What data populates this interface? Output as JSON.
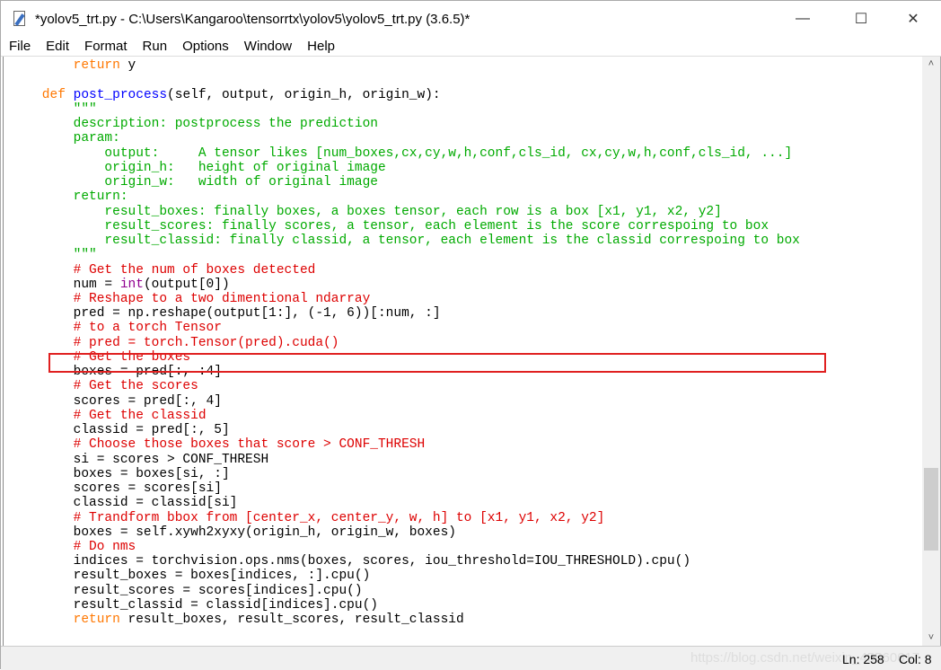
{
  "window": {
    "title": "*yolov5_trt.py - C:\\Users\\Kangaroo\\tensorrtx\\yolov5\\yolov5_trt.py (3.6.5)*",
    "minimize": "—",
    "maximize": "☐",
    "close": "✕"
  },
  "menu": [
    "File",
    "Edit",
    "Format",
    "Run",
    "Options",
    "Window",
    "Help"
  ],
  "code": [
    [
      [
        "n",
        "        ret, ... y"
      ]
    ],
    [
      [
        "k",
        "        return"
      ],
      [
        "n",
        " y"
      ]
    ],
    [],
    [
      [
        "k",
        "    def "
      ],
      [
        "d",
        "post_process"
      ],
      [
        "n",
        "(self, output, origin_h, origin_w):"
      ]
    ],
    [
      [
        "s",
        "        \"\"\""
      ]
    ],
    [
      [
        "s",
        "        description: postprocess the prediction"
      ]
    ],
    [
      [
        "s",
        "        param:"
      ]
    ],
    [
      [
        "s",
        "            output:     A tensor likes [num_boxes,cx,cy,w,h,conf,cls_id, cx,cy,w,h,conf,cls_id, ...]"
      ]
    ],
    [
      [
        "s",
        "            origin_h:   height of original image"
      ]
    ],
    [
      [
        "s",
        "            origin_w:   width of original image"
      ]
    ],
    [
      [
        "s",
        "        return:"
      ]
    ],
    [
      [
        "s",
        "            result_boxes: finally boxes, a boxes tensor, each row is a box [x1, y1, x2, y2]"
      ]
    ],
    [
      [
        "s",
        "            result_scores: finally scores, a tensor, each element is the score correspoing to box"
      ]
    ],
    [
      [
        "s",
        "            result_classid: finally classid, a tensor, each element is the classid correspoing to box"
      ]
    ],
    [
      [
        "s",
        "        \"\"\""
      ]
    ],
    [
      [
        "c",
        "        # Get the num of boxes detected"
      ]
    ],
    [
      [
        "n",
        "        num = "
      ],
      [
        "b",
        "int"
      ],
      [
        "n",
        "(output[0])"
      ]
    ],
    [
      [
        "c",
        "        # Reshape to a two dimentional ndarray"
      ]
    ],
    [
      [
        "n",
        "        pred = np.reshape(output[1:], (-1, 6))[:num, :]"
      ]
    ],
    [
      [
        "c",
        "        # to a torch Tensor"
      ]
    ],
    [
      [
        "c",
        "        # pred = torch.Tensor(pred).cuda()"
      ]
    ],
    [
      [
        "c",
        "        # Get the boxes"
      ]
    ],
    [
      [
        "n",
        "        boxes = pred[:, :4]"
      ]
    ],
    [
      [
        "c",
        "        # Get the scores"
      ]
    ],
    [
      [
        "n",
        "        scores = pred[:, 4]"
      ]
    ],
    [
      [
        "c",
        "        # Get the classid"
      ]
    ],
    [
      [
        "n",
        "        classid = pred[:, 5]"
      ]
    ],
    [
      [
        "c",
        "        # Choose those boxes that score > CONF_THRESH"
      ]
    ],
    [
      [
        "n",
        "        si = scores > CONF_THRESH"
      ]
    ],
    [
      [
        "n",
        "        boxes = boxes[si, :]"
      ]
    ],
    [
      [
        "n",
        "        scores = scores[si]"
      ]
    ],
    [
      [
        "n",
        "        classid = classid[si]"
      ]
    ],
    [
      [
        "c",
        "        # Trandform bbox from [center_x, center_y, w, h] to [x1, y1, x2, y2]"
      ]
    ],
    [
      [
        "n",
        "        boxes = self.xywh2xyxy(origin_h, origin_w, boxes)"
      ]
    ],
    [
      [
        "c",
        "        # Do nms"
      ]
    ],
    [
      [
        "n",
        "        indices = torchvision.ops.nms(boxes, scores, iou_threshold=IOU_THRESHOLD).cpu()"
      ]
    ],
    [
      [
        "n",
        "        result_boxes = boxes[indices, :].cpu()"
      ]
    ],
    [
      [
        "n",
        "        result_scores = scores[indices].cpu()"
      ]
    ],
    [
      [
        "n",
        "        result_classid = classid[indices].cpu()"
      ]
    ],
    [
      [
        "k",
        "        return"
      ],
      [
        "n",
        " result_boxes, result_scores, result_classid"
      ]
    ]
  ],
  "status": {
    "line": "Ln: 258",
    "col": "Col: 8",
    "watermark": "https://blog.csdn.net/weixin_45560617"
  },
  "scrollbar": {
    "up": "˄",
    "down": "˅"
  },
  "colors": {
    "keyword": "#ff7700",
    "defname": "#0000ff",
    "builtin": "#900090",
    "string": "#00aa00",
    "comment": "#dd0000",
    "highlight_box": "#e02020"
  }
}
